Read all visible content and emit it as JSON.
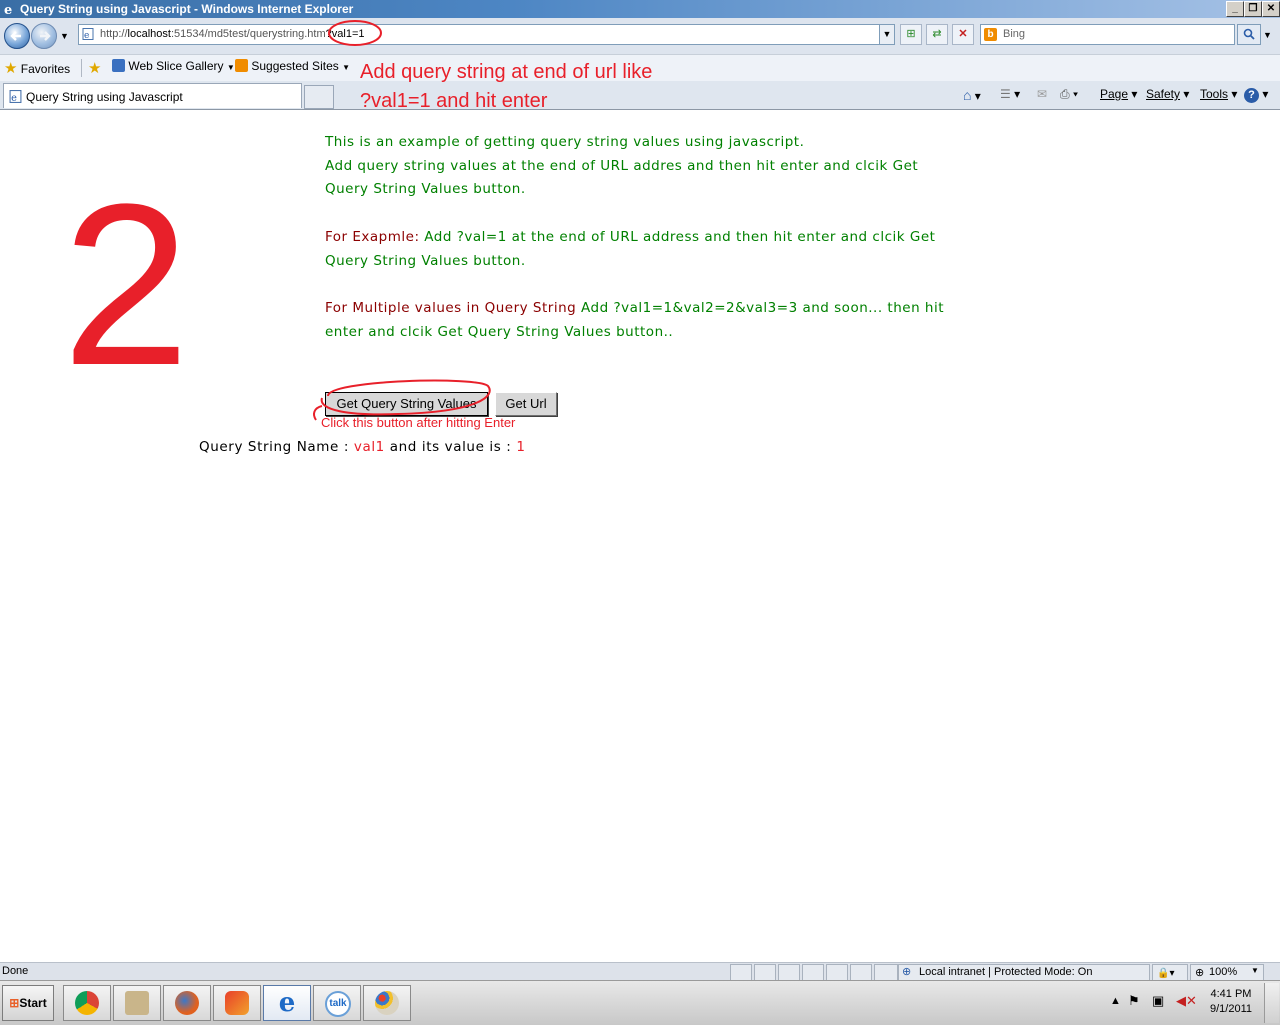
{
  "window": {
    "title": "Query String using Javascript - Windows Internet Explorer",
    "min_icon": "minimize-icon",
    "restore_icon": "restore-icon",
    "close_icon": "close-icon"
  },
  "nav": {
    "back_icon": "back-arrow-icon",
    "forward_icon": "forward-arrow-icon",
    "address_host_prefix": "http://",
    "address_host": "localhost",
    "address_rest": ":51534/md5test/querystring.htm",
    "address_query": "?val1=1",
    "search_placeholder": "Bing"
  },
  "favorites": {
    "favorites_label": "Favorites",
    "web_slice_label": "Web Slice Gallery",
    "suggested_label": "Suggested Sites"
  },
  "tabs": {
    "active_tab_title": "Query String using Javascript"
  },
  "commandbar": {
    "page_label": "Page",
    "safety_label": "Safety",
    "tools_label": "Tools"
  },
  "annotations": {
    "url_hint_line1": "Add query string at end of url like",
    "url_hint_line2": "?val1=1 and hit enter",
    "step_number": "2",
    "button_hint": "Click this button after hitting Enter"
  },
  "content": {
    "intro_line1": "This is an example of getting query string values using javascript.",
    "intro_line2": "Add query string values at the end of URL addres and then hit enter and clcik Get Query String Values button.",
    "example_label": "For Exapmle:",
    "example_text": " Add ?val=1 at the end of URL address and then hit enter and clcik Get Query String Values button.",
    "multiple_label1": "For Multiple values in ",
    "multiple_label2": "Query String",
    "multiple_text": " Add ?val1=1&val2=2&val3=3 and soon... then hit enter and clcik Get Query String Values button..",
    "get_qs_button": "Get Query String Values",
    "get_url_button": "Get Url",
    "result_prefix": "Query String Name : ",
    "result_name": "val1",
    "result_mid": " and its value is : ",
    "result_value": "1"
  },
  "status": {
    "left_text": "Done",
    "zone_text": "Local intranet | Protected Mode: On",
    "zoom_text": "100%"
  },
  "taskbar": {
    "start_label": "Start",
    "time": "4:41 PM",
    "date": "9/1/2011",
    "talk_label": "talk"
  }
}
